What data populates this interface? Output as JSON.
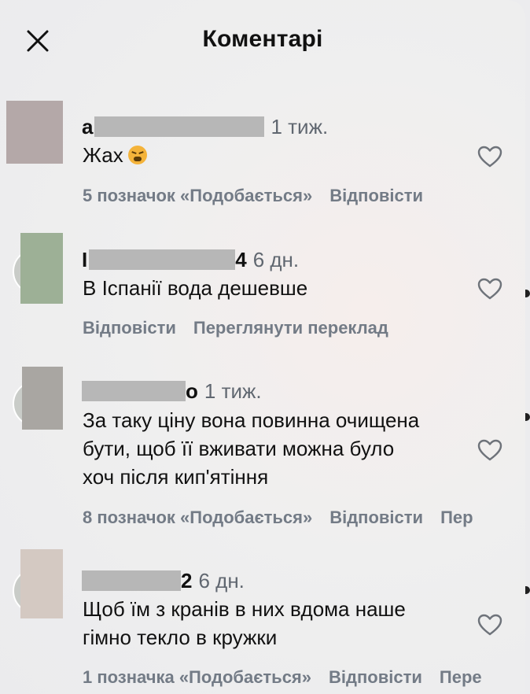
{
  "header": {
    "title": "Коментарі",
    "close_icon": "close-icon"
  },
  "comments": [
    {
      "username_visible": "a",
      "time": "1 тиж.",
      "text": "Жах",
      "emoji": "tired-face-emoji",
      "actions": [
        "5 позначок «Подобається»",
        "Відповісти"
      ]
    },
    {
      "username_visible": "I",
      "username_suffix": "4",
      "time": "6 дн.",
      "text": "В Іспанії вода дешевше",
      "actions": [
        "Відповісти",
        "Переглянути переклад"
      ]
    },
    {
      "username_visible": "",
      "username_suffix": "о",
      "time": "1 тиж.",
      "text_lines": [
        "За таку ціну вона повинна очищена",
        "бути, щоб її вживати можна було",
        "хоч після кип'ятіння"
      ],
      "actions": [
        "8 позначок «Подобається»",
        "Відповісти",
        "Пер"
      ]
    },
    {
      "username_visible": "",
      "username_suffix": "2",
      "time": "6 дн.",
      "text_lines": [
        "Щоб їм з кранів в них вдома наше",
        "гімно текло в кружки"
      ],
      "actions": [
        "1 позначка «Подобається»",
        "Відповісти",
        "Пере"
      ]
    }
  ],
  "colors": {
    "text": "#111111",
    "secondary": "#737b86",
    "redaction": "#b7b7b7"
  },
  "icons": {
    "like": "heart-outline-icon"
  }
}
